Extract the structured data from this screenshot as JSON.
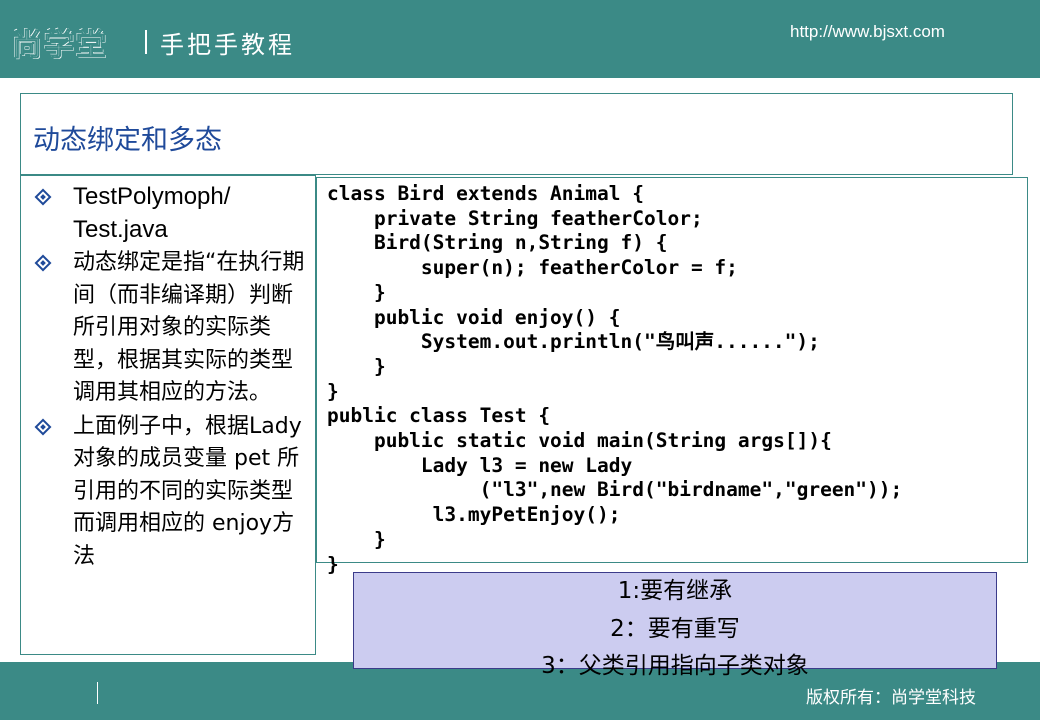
{
  "header": {
    "logo_text": "尚学堂",
    "tagline": "手把手教程",
    "url": "http://www.bjsxt.com"
  },
  "slide": {
    "title": "动态绑定和多态"
  },
  "bullets": [
    {
      "text": "TestPolymoph/ Test.java"
    },
    {
      "text": "动态绑定是指“在执行期间（而非编译期）判断所引用对象的实际类型，根据其实际的类型调用其相应的方法。"
    },
    {
      "text": "上面例子中，根据Lady 对象的成员变量 pet 所引用的不同的实际类型而调用相应的 enjoy方法"
    }
  ],
  "code": [
    "class Bird extends Animal {",
    "    private String featherColor;",
    "    Bird(String n,String f) {",
    "        super(n); featherColor = f;",
    "    }",
    "    public void enjoy() {",
    "        System.out.println(\"鸟叫声......\");",
    "    }",
    "}",
    "public class Test {",
    "    public static void main(String args[]){",
    "        Lady l3 = new Lady",
    "             (\"l3\",new Bird(\"birdname\",\"green\"));",
    "         l3.myPetEnjoy();",
    "    }",
    "}"
  ],
  "summary": [
    "1:要有继承",
    "2：要有重写",
    "3：父类引用指向子类对象"
  ],
  "footer": {
    "copyright": "版权所有：尚学堂科技"
  },
  "colors": {
    "teal": "#3b8a86",
    "title_blue": "#1f4a9a",
    "summary_bg": "#ccccf0"
  }
}
